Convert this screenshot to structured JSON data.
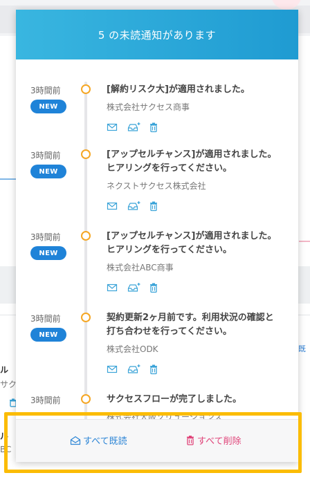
{
  "header": {
    "title": "5 の未読通知があります"
  },
  "notifications": [
    {
      "time": "3時間前",
      "badge": "NEW",
      "title": "[解約リスク大]が適用されました。",
      "company": "株式会社サクセス商事"
    },
    {
      "time": "3時間前",
      "badge": "NEW",
      "title": "[アップセルチャンス]が適用されました。ヒアリングを行ってください。",
      "company": "ネクストサクセス株式会社"
    },
    {
      "time": "3時間前",
      "badge": "NEW",
      "title": "[アップセルチャンス]が適用されました。ヒアリングを行ってください。",
      "company": "株式会社ABC商事"
    },
    {
      "time": "3時間前",
      "badge": "NEW",
      "title": "契約更新2ヶ月前です。利用状況の確認と打ち合わせを行ってください。",
      "company": "株式会社ODK"
    },
    {
      "time": "3時間前",
      "badge": "",
      "title": "サクセスフローが完了しました。",
      "company": "株式会社大阪ソリューションズ"
    }
  ],
  "actions": {
    "mail_icon": "mail-icon",
    "archive_icon": "inbox-plus-icon",
    "delete_icon": "trash-icon"
  },
  "footer": {
    "mark_all_read": "すべて既読",
    "delete_all": "すべて削除"
  },
  "background": {
    "left_texts": [
      "ル",
      "サク",
      "ル",
      "BC"
    ],
    "right_link": "既"
  },
  "colors": {
    "header_start": "#39b6e0",
    "header_end": "#1f9bd2",
    "badge": "#1f83d8",
    "timeline_dot": "#f5a623",
    "action_icon": "#3aa3d8",
    "read_all": "#2e86d6",
    "delete_all": "#e0457a",
    "highlight": "#fbbc05"
  }
}
